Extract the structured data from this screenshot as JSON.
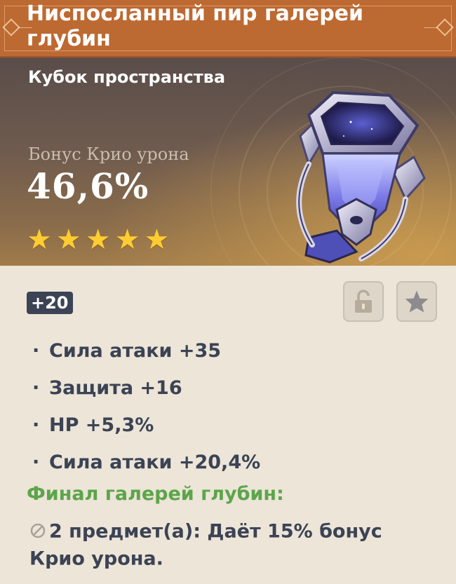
{
  "title": "Ниспосланный пир галерей глубин",
  "slot": "Кубок пространства",
  "main_stat": {
    "name": "Бонус Крио урона",
    "value": "46,6%"
  },
  "rarity": 5,
  "stars": [
    "★",
    "★",
    "★",
    "★",
    "★"
  ],
  "level": "+20",
  "buttons": {
    "lock_icon": "lock-open-icon",
    "favorite_icon": "star-icon"
  },
  "bullet": "·",
  "substats": [
    {
      "text": "Сила атаки +35"
    },
    {
      "text": "Защита +16"
    },
    {
      "text": "HP +5,3%"
    },
    {
      "text": "Сила атаки +20,4%"
    }
  ],
  "set": {
    "name": "Финал галерей глубин:",
    "bonus_2pc": "2 предмет(а): Даёт 15% бонус Крио урона."
  },
  "colors": {
    "title_bar": "#bd6932",
    "set_name": "#5ca54a",
    "star": "#ffcc32",
    "text_dark": "#3b4354",
    "body_bg": "#ece5d8"
  }
}
